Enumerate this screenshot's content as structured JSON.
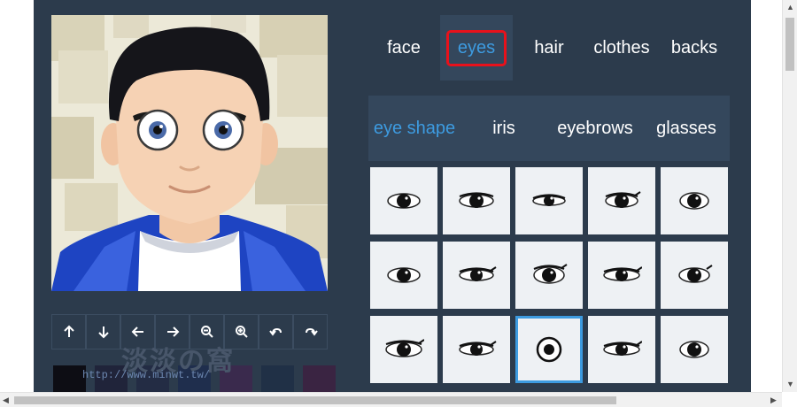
{
  "categories": [
    {
      "label": "face",
      "active": false
    },
    {
      "label": "eyes",
      "active": true
    },
    {
      "label": "hair",
      "active": false
    },
    {
      "label": "clothes",
      "active": false
    },
    {
      "label": "backs",
      "active": false
    }
  ],
  "subcategories": [
    {
      "label": "eye shape",
      "active": true
    },
    {
      "label": "iris",
      "active": false
    },
    {
      "label": "eyebrows",
      "active": false
    },
    {
      "label": "glasses",
      "active": false
    }
  ],
  "toolbar": [
    {
      "icon": "arrow-up-icon"
    },
    {
      "icon": "arrow-down-icon"
    },
    {
      "icon": "arrow-left-icon"
    },
    {
      "icon": "arrow-right-icon"
    },
    {
      "icon": "zoom-out-icon"
    },
    {
      "icon": "zoom-in-icon"
    },
    {
      "icon": "undo-icon"
    },
    {
      "icon": "redo-icon"
    }
  ],
  "swatch_colors": [
    "#0d0d14",
    "#20243a",
    "#232c44",
    "#1f2e4d",
    "#3a2a4d",
    "#203046",
    "#3a2442"
  ],
  "eye_shapes": [
    "oval",
    "almond",
    "narrow",
    "almond-lash",
    "round",
    "oval",
    "lidded",
    "lashed",
    "cat",
    "wide",
    "heavy-lashed",
    "narrow-lashed",
    "dot",
    "slim-lash",
    "round"
  ],
  "selected_eye_shape": 12,
  "watermark": {
    "text": "淡淡の窩",
    "url": "http://www.minwt.tw/"
  },
  "colors": {
    "panel": "#2c3b4c",
    "active_tab_bg": "#34475c",
    "accent": "#3d9be0",
    "highlight_box": "#e8111b",
    "tile": "#eef1f4"
  }
}
